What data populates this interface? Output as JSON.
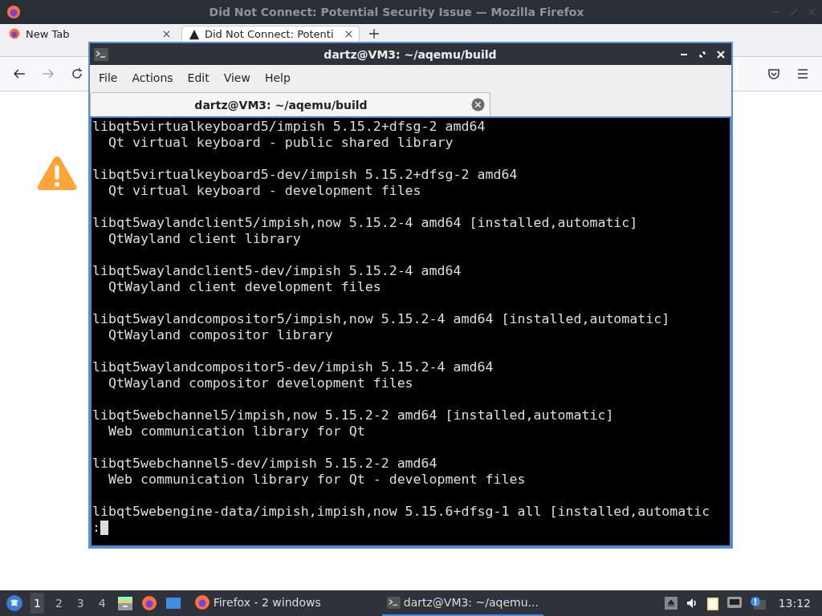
{
  "firefox": {
    "title": "Did Not Connect: Potential Security Issue — Mozilla Firefox",
    "tabs": [
      {
        "label": "New Tab",
        "selected": false
      },
      {
        "label": "Did Not Connect: Potenti",
        "selected": true
      }
    ]
  },
  "terminal": {
    "title": "dartz@VM3: ~/aqemu/build",
    "menu": [
      "File",
      "Actions",
      "Edit",
      "View",
      "Help"
    ],
    "tab": {
      "label": "dartz@VM3: ~/aqemu/build",
      "selected": true
    },
    "entries": [
      {
        "header": "libqt5virtualkeyboard5/impish 5.15.2+dfsg-2 amd64",
        "description": "  Qt virtual keyboard - public shared library"
      },
      {
        "header": "libqt5virtualkeyboard5-dev/impish 5.15.2+dfsg-2 amd64",
        "description": "  Qt virtual keyboard - development files"
      },
      {
        "header": "libqt5waylandclient5/impish,now 5.15.2-4 amd64 [installed,automatic]",
        "description": "  QtWayland client library"
      },
      {
        "header": "libqt5waylandclient5-dev/impish 5.15.2-4 amd64",
        "description": "  QtWayland client development files"
      },
      {
        "header": "libqt5waylandcompositor5/impish,now 5.15.2-4 amd64 [installed,automatic]",
        "description": "  QtWayland compositor library"
      },
      {
        "header": "libqt5waylandcompositor5-dev/impish 5.15.2-4 amd64",
        "description": "  QtWayland compositor development files"
      },
      {
        "header": "libqt5webchannel5/impish,now 5.15.2-2 amd64 [installed,automatic]",
        "description": "  Web communication library for Qt"
      },
      {
        "header": "libqt5webchannel5-dev/impish 5.15.2-2 amd64",
        "description": "  Web communication library for Qt - development files"
      },
      {
        "header": "libqt5webengine-data/impish,impish,now 5.15.6+dfsg-1 all [installed,automatic"
      }
    ],
    "prompt": ":"
  },
  "taskbar": {
    "workspaces": [
      {
        "label": "1",
        "selected": true
      },
      {
        "label": "2",
        "selected": false
      },
      {
        "label": "3",
        "selected": false
      },
      {
        "label": "4",
        "selected": false
      }
    ],
    "tasks": [
      {
        "label": "Firefox - 2 windows",
        "kind": "firefox",
        "selected": false
      },
      {
        "label": "dartz@VM3: ~/aqemu...",
        "kind": "terminal",
        "selected": true
      }
    ],
    "clock": "13:12"
  }
}
